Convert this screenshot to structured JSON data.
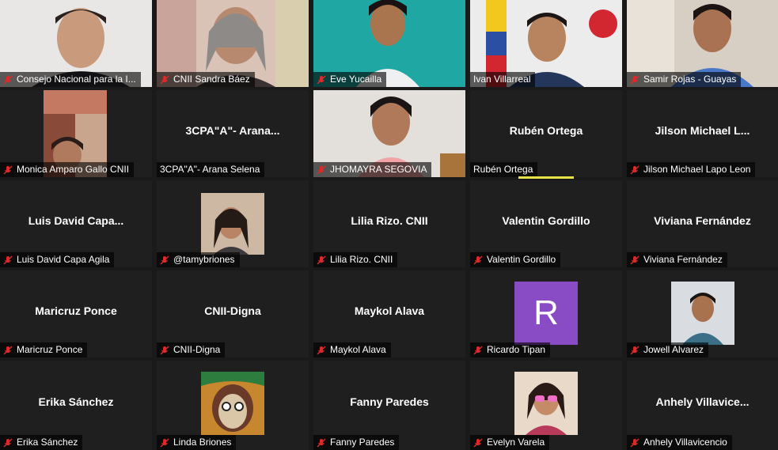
{
  "meeting": {
    "participants": [
      {
        "display": "",
        "label": "Consejo Nacional para la I..."
      },
      {
        "display": "",
        "label": "CNII Sandra Báez"
      },
      {
        "display": "",
        "label": "Eve Yucailla"
      },
      {
        "display": "",
        "label": "Ivan Villarreal"
      },
      {
        "display": "",
        "label": "Samir Rojas - Guayas"
      },
      {
        "display": "",
        "label": "Monica Amparo Gallo CNII"
      },
      {
        "display": "3CPA\"A\"-  Arana...",
        "label": "3CPA\"A\"- Arana Selena"
      },
      {
        "display": "",
        "label": "JHOMAYRA SEGOVIA"
      },
      {
        "display": "Rubén Ortega",
        "label": "Rubén Ortega"
      },
      {
        "display": "Jilson  Michael  L...",
        "label": "Jilson Michael Lapo Leon"
      },
      {
        "display": "Luis  David  Capa...",
        "label": "Luis David Capa Agila"
      },
      {
        "display": "",
        "label": "@tamybriones"
      },
      {
        "display": "Lilia Rizo. CNII",
        "label": "Lilia Rizo. CNII"
      },
      {
        "display": "Valentin Gordillo",
        "label": "Valentin Gordillo"
      },
      {
        "display": "Viviana Fernández",
        "label": "Viviana Fernández"
      },
      {
        "display": "Maricruz Ponce",
        "label": "Maricruz Ponce"
      },
      {
        "display": "CNII-Digna",
        "label": "CNII-Digna"
      },
      {
        "display": "Maykol Alava",
        "label": "Maykol Alava"
      },
      {
        "display": "R",
        "label": "Ricardo Tipan",
        "avatar_color": "#8a4cc4"
      },
      {
        "display": "",
        "label": "Jowell Alvarez"
      },
      {
        "display": "Erika Sánchez",
        "label": "Erika Sánchez"
      },
      {
        "display": "",
        "label": "Linda Briones"
      },
      {
        "display": "Fanny Paredes",
        "label": "Fanny Paredes"
      },
      {
        "display": "",
        "label": "Evelyn Varela"
      },
      {
        "display": "Anhely  Villavice...",
        "label": "Anhely Villavicencio"
      }
    ]
  },
  "colors": {
    "muted_mic": "#e02828",
    "active_speaker": "#e6e34a",
    "tile_bg": "#1f1f1f"
  },
  "icons": {
    "muted": "mic-muted-icon"
  }
}
